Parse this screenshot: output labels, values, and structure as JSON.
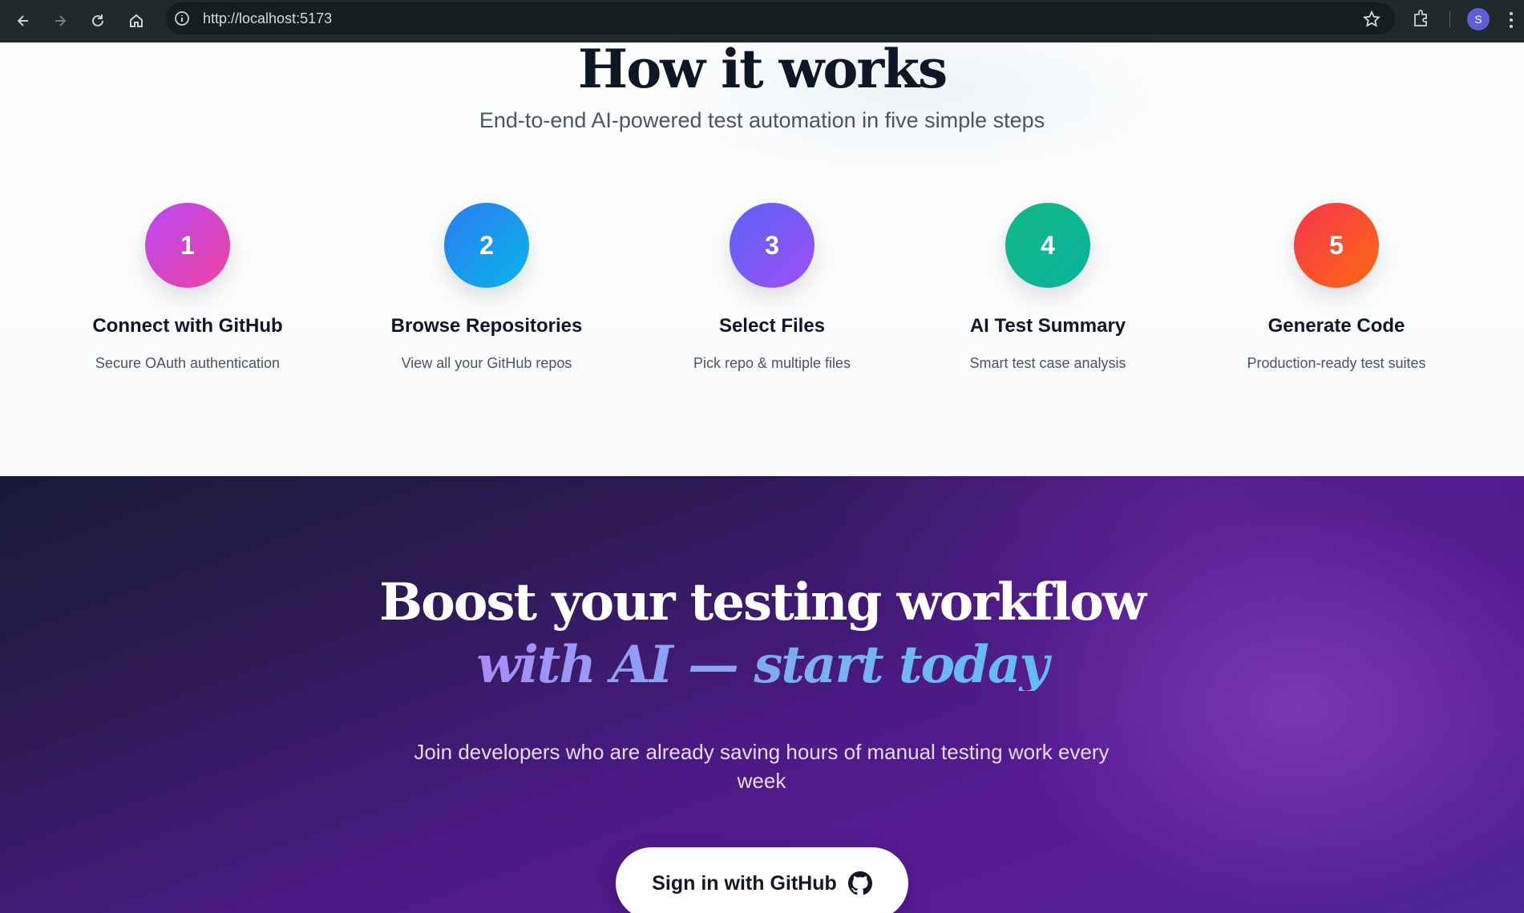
{
  "browser": {
    "url": "http://localhost:5173",
    "profile_initial": "S"
  },
  "how": {
    "title": "How it works",
    "subtitle": "End-to-end AI-powered test automation in five simple steps",
    "steps": [
      {
        "number": "1",
        "title": "Connect with GitHub",
        "desc": "Secure OAuth authentication",
        "colors": [
          "#b84af5",
          "#f0429f"
        ]
      },
      {
        "number": "2",
        "title": "Browse Repositories",
        "desc": "View all your GitHub repos",
        "colors": [
          "#2b7cf3",
          "#0ab4e8"
        ]
      },
      {
        "number": "3",
        "title": "Select Files",
        "desc": "Pick repo & multiple files",
        "colors": [
          "#5b63f6",
          "#a04ff3"
        ]
      },
      {
        "number": "4",
        "title": "AI Test Summary",
        "desc": "Smart test case analysis",
        "colors": [
          "#12b887",
          "#0bb39b"
        ]
      },
      {
        "number": "5",
        "title": "Generate Code",
        "desc": "Production-ready test suites",
        "colors": [
          "#f7344f",
          "#fb6a12"
        ]
      }
    ]
  },
  "cta": {
    "title_line1": "Boost your testing workflow",
    "title_line2": "with AI — start today",
    "subtitle": "Join developers who are already saving hours of manual testing work every week",
    "button_label": "Sign in with GitHub"
  }
}
